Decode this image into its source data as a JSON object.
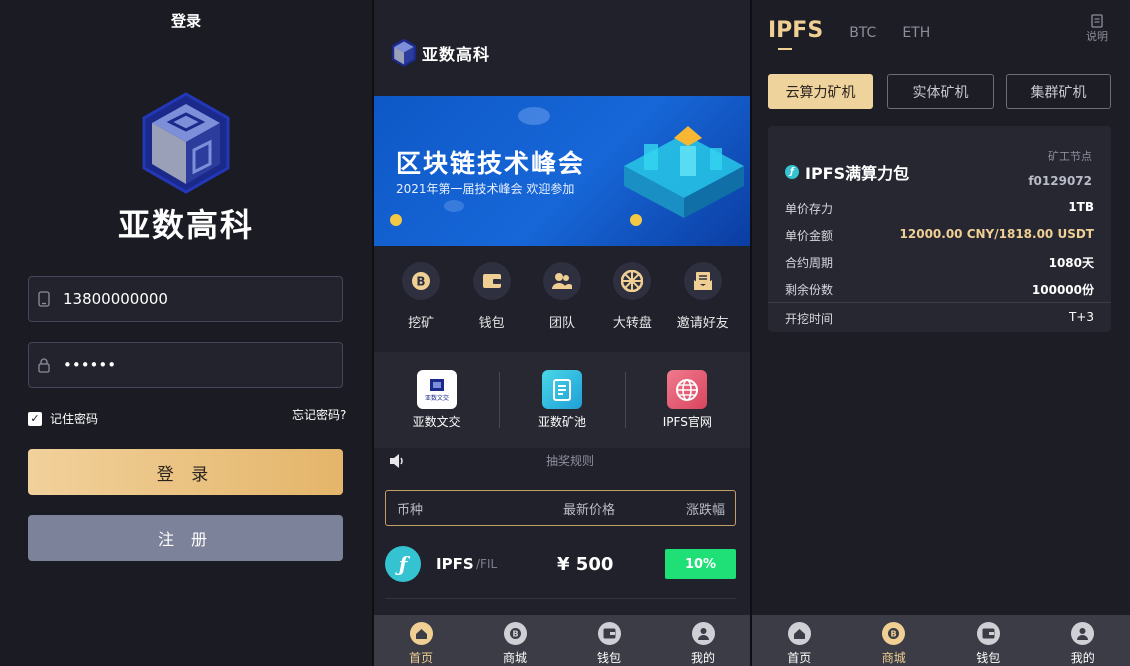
{
  "login": {
    "title": "登录",
    "brand": "亚数高科",
    "phone_value": "13800000000",
    "password_value": "••••••",
    "remember_label": "记住密码",
    "forgot_label": "忘记密码?",
    "login_button": "登 录",
    "register_button": "注 册"
  },
  "home": {
    "brand": "亚数高科",
    "banner": {
      "title": "区块链技术峰会",
      "subtitle": "2021年第一届技术峰会 欢迎参加"
    },
    "quick_actions": [
      {
        "label": "挖矿",
        "icon": "bitcoin-icon"
      },
      {
        "label": "钱包",
        "icon": "wallet-icon"
      },
      {
        "label": "团队",
        "icon": "team-icon"
      },
      {
        "label": "大转盘",
        "icon": "wheel-icon"
      },
      {
        "label": "邀请好友",
        "icon": "invite-icon"
      }
    ],
    "links": [
      {
        "label": "亚数文交",
        "logo_text": "亚数文交",
        "color": "#ffffff"
      },
      {
        "label": "亚数矿池",
        "color": "#2bb9d9"
      },
      {
        "label": "IPFS官网",
        "color": "#e05a76"
      }
    ],
    "notice": "抽奖规则",
    "market": {
      "headers": [
        "币种",
        "最新价格",
        "涨跌幅"
      ],
      "rows": [
        {
          "name": "IPFS",
          "pair": "/FIL",
          "price": "¥ 500",
          "change": "10%"
        }
      ]
    },
    "tabbar": [
      {
        "label": "首页",
        "icon": "home-icon",
        "active": true
      },
      {
        "label": "商城",
        "icon": "mall-icon",
        "active": false
      },
      {
        "label": "钱包",
        "icon": "wallet-icon",
        "active": false
      },
      {
        "label": "我的",
        "icon": "profile-icon",
        "active": false
      }
    ]
  },
  "mining": {
    "coin_tabs": [
      "IPFS",
      "BTC",
      "ETH"
    ],
    "help_label": "说明",
    "miner_tabs": [
      "云算力矿机",
      "实体矿机",
      "集群矿机"
    ],
    "card": {
      "title": "IPFS满算力包",
      "node_label": "矿工节点",
      "node_value": "f0129072",
      "rows": [
        {
          "key": "单价存力",
          "value": "1TB"
        },
        {
          "key": "单价金额",
          "value": "12000.00 CNY/1818.00 USDT"
        },
        {
          "key": "合约周期",
          "value": "1080天"
        },
        {
          "key": "剩余份数",
          "value": "100000份"
        },
        {
          "key": "开挖时间",
          "value": "T+3"
        }
      ]
    },
    "tabbar": [
      {
        "label": "首页",
        "icon": "home-icon",
        "active": false
      },
      {
        "label": "商城",
        "icon": "mall-icon",
        "active": true
      },
      {
        "label": "钱包",
        "icon": "wallet-icon",
        "active": false
      },
      {
        "label": "我的",
        "icon": "profile-icon",
        "active": false
      }
    ]
  },
  "colors": {
    "accent_gold": "#efcf94",
    "positive_green": "#1ee077",
    "filecoin_teal": "#35c3d2"
  }
}
